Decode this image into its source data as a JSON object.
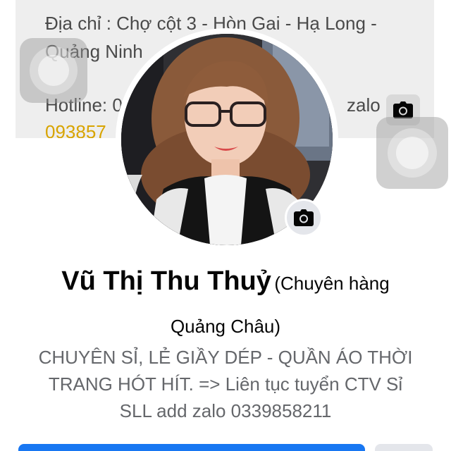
{
  "cover": {
    "lines": [
      "Địa chỉ : Chợ cột 3 - Hòn Gai - Hạ Long -",
      "Quảng Ninh",
      "Hotline: 0",
      "093857"
    ],
    "trailing_text": "zalo"
  },
  "icons": {
    "cover_camera": "camera-icon",
    "avatar_camera": "camera-icon"
  },
  "profile": {
    "name": "Vũ Thị Thu Thuỷ",
    "alternate_name_part1": "(Chuyên hàng",
    "alternate_name_part2": "Quảng Châu)",
    "bio_lines": [
      "CHUYÊN SỈ, LẺ GIẦY DÉP - QUẦN ÁO THỜI",
      "TRANG HÓT HÍT. => Liên tục tuyển CTV Sỉ",
      "SLL add zalo 0339858211"
    ]
  },
  "colors": {
    "primary": "#1877f2",
    "secondary": "#e4e6eb",
    "text": "#050505",
    "muted": "#65676b"
  }
}
